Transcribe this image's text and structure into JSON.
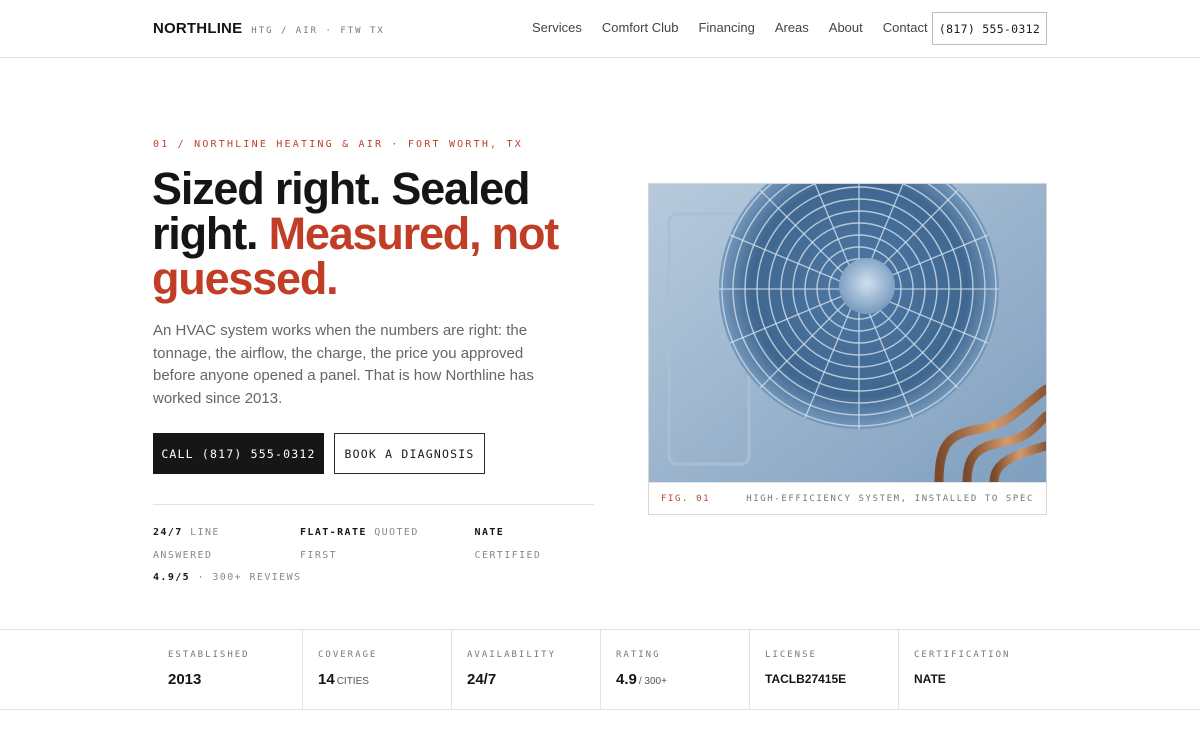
{
  "header": {
    "brand": "NORTHLINE",
    "tagline": "HTG / AIR · FTW TX",
    "nav": [
      "Services",
      "Comfort Club",
      "Financing",
      "Areas",
      "About",
      "Contact"
    ],
    "phone": "(817) 555-0312"
  },
  "hero": {
    "eyebrow": "01 / NORTHLINE HEATING & AIR · FORT WORTH, TX",
    "headline_dark": "Sized right. Sealed right.",
    "headline_accent": "Measured, not guessed.",
    "lede": "An HVAC system works when the numbers are right: the tonnage, the airflow, the charge, the price you approved before anyone opened a panel. That is how Northline has worked since 2013.",
    "cta_primary": "CALL (817) 555-0312",
    "cta_secondary": "BOOK A DIAGNOSIS",
    "facts": [
      {
        "strong": "24/7",
        "text": "LINE ANSWERED"
      },
      {
        "strong": "FLAT-RATE",
        "text": "QUOTED FIRST"
      },
      {
        "strong": "NATE",
        "text": "CERTIFIED"
      },
      {
        "strong": "4.9/5",
        "text": "· 300+ REVIEWS"
      }
    ]
  },
  "figure": {
    "number": "FIG. 01",
    "caption": "HIGH-EFFICIENCY SYSTEM, INSTALLED TO SPEC",
    "image_subject": "outdoor-ac-condenser-fan"
  },
  "stats": [
    {
      "label": "ESTABLISHED",
      "value": "2013",
      "suffix": ""
    },
    {
      "label": "COVERAGE",
      "value": "14",
      "suffix": "CITIES"
    },
    {
      "label": "AVAILABILITY",
      "value": "24/7",
      "suffix": ""
    },
    {
      "label": "RATING",
      "value": "4.9",
      "suffix": "/ 300+"
    },
    {
      "label": "LICENSE",
      "value": "TACLB27415E",
      "suffix": ""
    },
    {
      "label": "CERTIFICATION",
      "value": "NATE",
      "suffix": ""
    }
  ],
  "colors": {
    "accent": "#c13d26",
    "ink": "#151515",
    "muted": "#666666"
  }
}
